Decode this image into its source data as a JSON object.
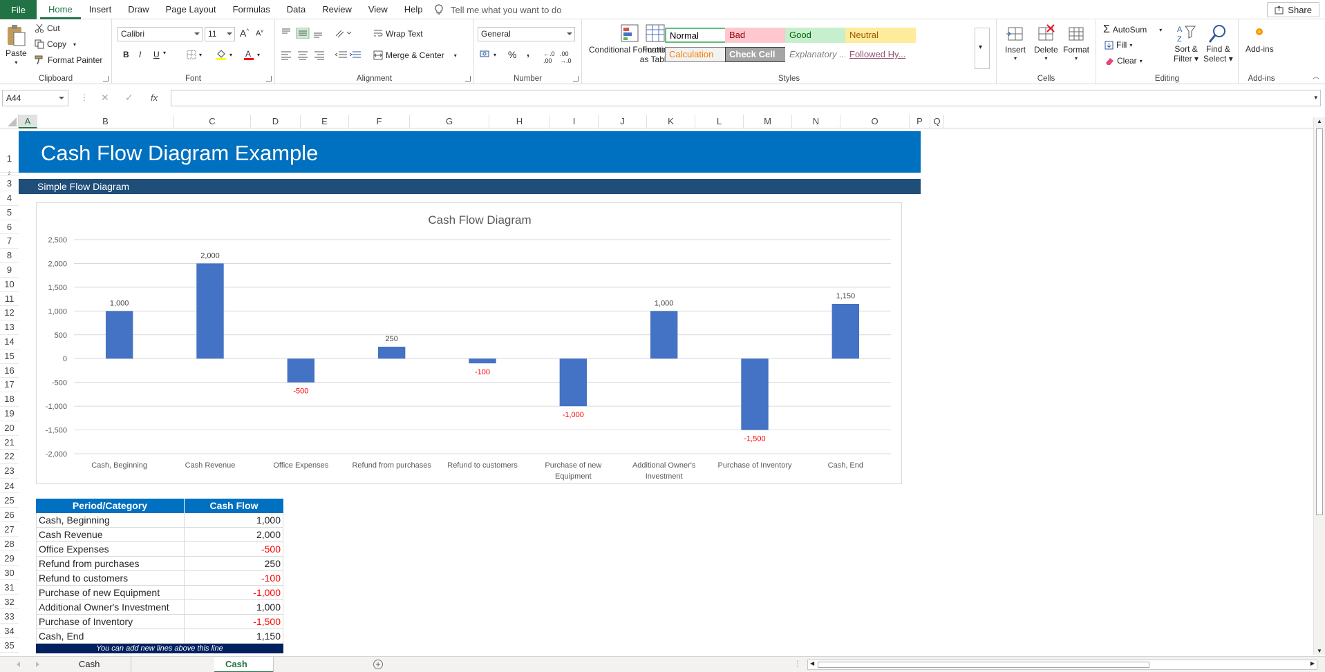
{
  "ribbon_tabs": {
    "file": "File",
    "items": [
      "Home",
      "Insert",
      "Draw",
      "Page Layout",
      "Formulas",
      "Data",
      "Review",
      "View",
      "Help"
    ],
    "active": "Home",
    "tell_me": "Tell me what you want to do",
    "share": "Share"
  },
  "clipboard": {
    "paste": "Paste",
    "cut": "Cut",
    "copy": "Copy",
    "format_painter": "Format Painter",
    "label": "Clipboard"
  },
  "font": {
    "name": "Calibri",
    "size": "11",
    "bold": "B",
    "italic": "I",
    "underline": "U",
    "label": "Font"
  },
  "alignment": {
    "wrap_text": "Wrap Text",
    "merge_center": "Merge & Center",
    "label": "Alignment"
  },
  "number": {
    "format": "General",
    "percent": "%",
    "comma": ",",
    "label": "Number"
  },
  "styles": {
    "conditional": "Conditional Formatting",
    "format_table": "Format as Table",
    "cells": [
      {
        "text": "Normal",
        "bg": "#ffffff",
        "color": "#000000",
        "border": "#5fbe7d"
      },
      {
        "text": "Bad",
        "bg": "#ffc7ce",
        "color": "#9c0006",
        "border": "#ffc7ce"
      },
      {
        "text": "Good",
        "bg": "#c6efce",
        "color": "#006100",
        "border": "#c6efce"
      },
      {
        "text": "Neutral",
        "bg": "#ffeb9c",
        "color": "#9c5700",
        "border": "#ffeb9c"
      },
      {
        "text": "Calculation",
        "bg": "#f2f2f2",
        "color": "#fa7d00",
        "border": "#7f7f7f"
      },
      {
        "text": "Check Cell",
        "bg": "#a5a5a5",
        "color": "#ffffff",
        "border": "#3f3f3f"
      },
      {
        "text": "Explanatory ...",
        "bg": "#ffffff",
        "color": "#7f7f7f",
        "border": "#ffffff"
      },
      {
        "text": "Followed Hy...",
        "bg": "#ffffff",
        "color": "#954f72",
        "border": "#ffffff"
      }
    ],
    "label": "Styles"
  },
  "cells_group": {
    "insert": "Insert",
    "delete": "Delete",
    "format": "Format",
    "label": "Cells"
  },
  "editing": {
    "autosum": "AutoSum",
    "fill": "Fill",
    "clear": "Clear",
    "sort_filter_1": "Sort &",
    "sort_filter_2": "Filter",
    "find_select_1": "Find &",
    "find_select_2": "Select",
    "label": "Editing"
  },
  "addins": {
    "button": "Add-ins",
    "label": "Add-ins"
  },
  "formula_bar": {
    "name_box": "A44",
    "fx": "fx",
    "value": ""
  },
  "columns": [
    "A",
    "B",
    "C",
    "D",
    "E",
    "F",
    "G",
    "H",
    "I",
    "J",
    "K",
    "L",
    "M",
    "N",
    "O",
    "P",
    "Q"
  ],
  "selected_column": "A",
  "rows": [
    "1",
    "2",
    "3",
    "4",
    "5",
    "6",
    "7",
    "8",
    "9",
    "10",
    "11",
    "12",
    "13",
    "14",
    "15",
    "16",
    "17",
    "18",
    "19",
    "20",
    "21",
    "22",
    "23",
    "24",
    "25",
    "26",
    "27",
    "28",
    "29",
    "30",
    "31",
    "32",
    "33",
    "34",
    "35"
  ],
  "sheet": {
    "title": "Cash Flow Diagram Example",
    "subtitle": "Simple Flow Diagram"
  },
  "chart_data": {
    "type": "bar",
    "title": "Cash Flow Diagram",
    "categories": [
      "Cash, Beginning",
      "Cash Revenue",
      "Office Expenses",
      "Refund from purchases",
      "Refund to customers",
      "Purchase of new Equipment",
      "Additional Owner's Investment",
      "Purchase of Inventory",
      "Cash, End"
    ],
    "category_lines": [
      [
        "Cash, Beginning"
      ],
      [
        "Cash Revenue"
      ],
      [
        "Office Expenses"
      ],
      [
        "Refund from purchases"
      ],
      [
        "Refund to customers"
      ],
      [
        "Purchase of new",
        "Equipment"
      ],
      [
        "Additional Owner's",
        "Investment"
      ],
      [
        "Purchase of Inventory"
      ],
      [
        "Cash, End"
      ]
    ],
    "values": [
      1000,
      2000,
      -500,
      250,
      -100,
      -1000,
      1000,
      -1500,
      1150
    ],
    "value_labels": [
      "1,000",
      "2,000",
      "-500",
      "250",
      "-100",
      "-1,000",
      "1,000",
      "-1,500",
      "1,150"
    ],
    "yticks": [
      "2,500",
      "2,000",
      "1,500",
      "1,000",
      "500",
      "0",
      "-500",
      "-1,000",
      "-1,500",
      "-2,000"
    ],
    "ylim": [
      -2000,
      2500
    ],
    "bar_color": "#4472c4",
    "negative_label_color": "#ff0000",
    "grid": true,
    "legend": "none"
  },
  "table": {
    "headers": [
      "Period/Category",
      "Cash Flow"
    ],
    "rows": [
      {
        "category": "Cash, Beginning",
        "value": "1,000",
        "neg": false
      },
      {
        "category": "Cash Revenue",
        "value": "2,000",
        "neg": false
      },
      {
        "category": "Office Expenses",
        "value": "-500",
        "neg": true
      },
      {
        "category": "Refund from purchases",
        "value": "250",
        "neg": false
      },
      {
        "category": "Refund to customers",
        "value": "-100",
        "neg": true
      },
      {
        "category": "Purchase of new Equipment",
        "value": "-1,000",
        "neg": true
      },
      {
        "category": "Additional Owner's Investment",
        "value": "1,000",
        "neg": false
      },
      {
        "category": "Purchase of Inventory",
        "value": "-1,500",
        "neg": true
      },
      {
        "category": "Cash, End",
        "value": "1,150",
        "neg": false
      }
    ],
    "footer": "You can add new lines above this line"
  },
  "sheet_tabs": {
    "items": [
      "Cash Flow Diagram Generator",
      "Cash Flow Diagram Example"
    ],
    "active": "Cash Flow Diagram Example",
    "add": "+"
  }
}
